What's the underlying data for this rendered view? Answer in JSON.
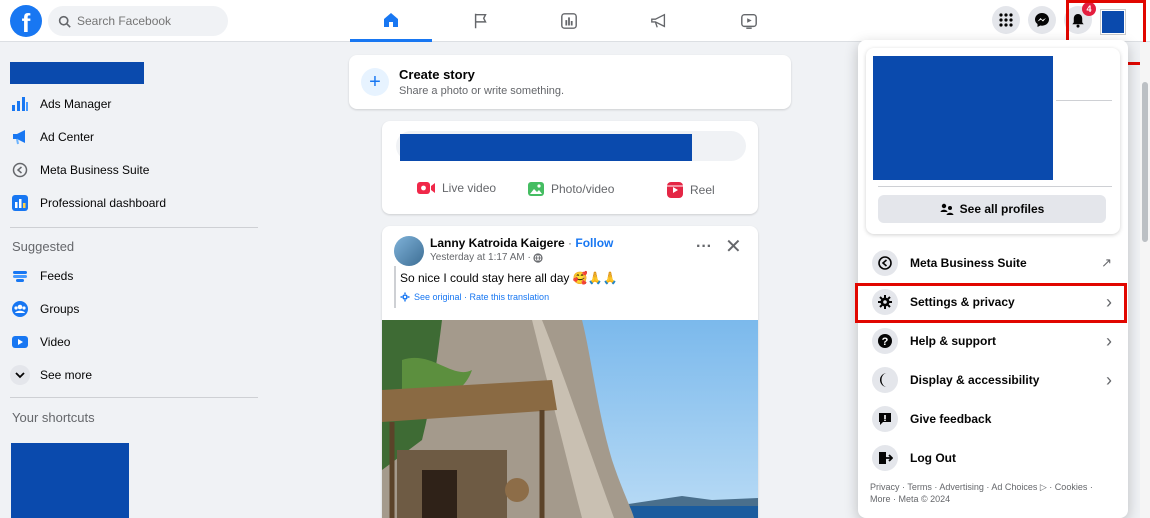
{
  "search": {
    "placeholder": "Search Facebook"
  },
  "topbar": {
    "notification_count": "4"
  },
  "sidebar": {
    "items": [
      {
        "label": "Ads Manager",
        "icon": "ads-manager-icon"
      },
      {
        "label": "Ad Center",
        "icon": "ad-center-icon"
      },
      {
        "label": "Meta Business Suite",
        "icon": "meta-business-suite-icon"
      },
      {
        "label": "Professional dashboard",
        "icon": "professional-dashboard-icon"
      }
    ],
    "suggested_heading": "Suggested",
    "suggested": [
      {
        "label": "Feeds",
        "icon": "feeds-icon"
      },
      {
        "label": "Groups",
        "icon": "groups-icon"
      },
      {
        "label": "Video",
        "icon": "video-icon"
      },
      {
        "label": "See more",
        "icon": "chevron-down-icon"
      }
    ],
    "shortcuts_heading": "Your shortcuts"
  },
  "create_story": {
    "title": "Create story",
    "subtitle": "Share a photo or write something."
  },
  "composer": {
    "actions": [
      {
        "label": "Live video",
        "icon": "live-video-icon",
        "color": "#f02849"
      },
      {
        "label": "Photo/video",
        "icon": "photo-video-icon",
        "color": "#45bd62"
      },
      {
        "label": "Reel",
        "icon": "reel-icon",
        "color": "#e42645"
      }
    ]
  },
  "post": {
    "author": "Lanny Katroida Kaigere",
    "separator": " · ",
    "follow_label": "Follow",
    "time": "Yesterday at 1:17 AM · ",
    "text": "So nice I could stay here all day 🥰🙏🙏",
    "translation": "See original · Rate this translation"
  },
  "dropdown": {
    "see_all_profiles": "See all profiles",
    "items": [
      {
        "label": "Meta Business Suite",
        "icon": "meta-business-suite-icon",
        "arrow": "↗"
      },
      {
        "label": "Settings & privacy",
        "icon": "gear-icon",
        "arrow": "›"
      },
      {
        "label": "Help & support",
        "icon": "help-icon",
        "arrow": "›"
      },
      {
        "label": "Display & accessibility",
        "icon": "moon-icon",
        "arrow": "›"
      },
      {
        "label": "Give feedback",
        "icon": "feedback-icon",
        "arrow": ""
      },
      {
        "label": "Log Out",
        "icon": "logout-icon",
        "arrow": ""
      }
    ],
    "footer": "Privacy · Terms · Advertising · Ad Choices ▷ · Cookies · More · Meta © 2024"
  },
  "colors": {
    "brand": "#1877f2",
    "redaction": "#0a4aad",
    "highlight": "#e10600",
    "badge": "#e41e3f"
  }
}
